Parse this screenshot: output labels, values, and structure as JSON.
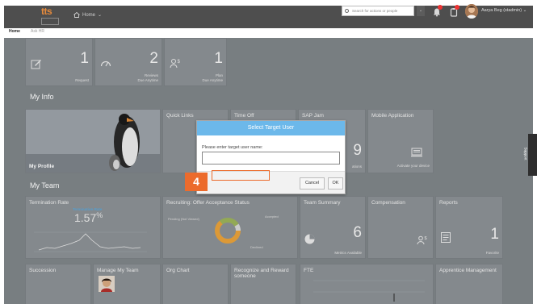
{
  "header": {
    "logo_text": "tts",
    "home_label": "Home",
    "home_caret": "⌄",
    "search_placeholder": "Search for actions or people",
    "search_dropdown": "⌄",
    "user_name": "Aarya Beg (stadmin)",
    "user_caret": "⌄"
  },
  "subnav": {
    "items": [
      "Home",
      "Ask HR"
    ]
  },
  "quick_tiles": [
    {
      "num": "1",
      "label1": "Request",
      "label2": "",
      "icon": "pencil-icon"
    },
    {
      "num": "2",
      "label1": "Reviews",
      "label2": "Due Anytime",
      "icon": "gauge-icon"
    },
    {
      "num": "1",
      "label1": "Plan",
      "label2": "Due Anytime",
      "icon": "people-money-icon"
    }
  ],
  "sections": {
    "my_info": "My Info",
    "my_team": "My Team"
  },
  "my_info_tiles": {
    "profile": "My Profile",
    "quick_links": "Quick Links",
    "time_off": "Time Off",
    "sap_jam": "SAP Jam",
    "sap_jam_partial_num": "9",
    "sap_jam_partial_lbl": "ations",
    "mobile_app": "Mobile Application",
    "mobile_activate": "Activate your device"
  },
  "team_tiles": {
    "termination": {
      "title": "Termination Rate",
      "subtitle": "Termination Rate",
      "value": "1.57",
      "unit": "%"
    },
    "recruiting": {
      "title": "Recruiting: Offer Acceptance Status",
      "legend_pending": "Pending (Not Viewed)",
      "legend_accepted": "Accepted",
      "legend_declined": "Declined"
    },
    "team_summary": {
      "title": "Team Summary",
      "num": "6",
      "label": "Metrics Available"
    },
    "compensation": {
      "title": "Compensation"
    },
    "reports": {
      "title": "Reports",
      "num": "1",
      "label": "Favorite"
    }
  },
  "bottom_tiles": {
    "succession": "Succession",
    "manage_team": "Manage My Team",
    "org_chart": "Org Chart",
    "recognize": "Recognize and Reward someone",
    "fte": "FTE",
    "apprentice": "Apprentice Management"
  },
  "dialog": {
    "title": "Select Target User",
    "label": "Please enter target user name:",
    "input_value": "",
    "cancel": "Cancel",
    "ok": "OK"
  },
  "annotation": {
    "step": "4"
  },
  "support_tab": "Support",
  "colors": {
    "topbar": "#4e4e4e",
    "dialog_header": "#6cb8ea",
    "annotation": "#ec6b2c",
    "dashboard_bg": "#7f8588"
  }
}
